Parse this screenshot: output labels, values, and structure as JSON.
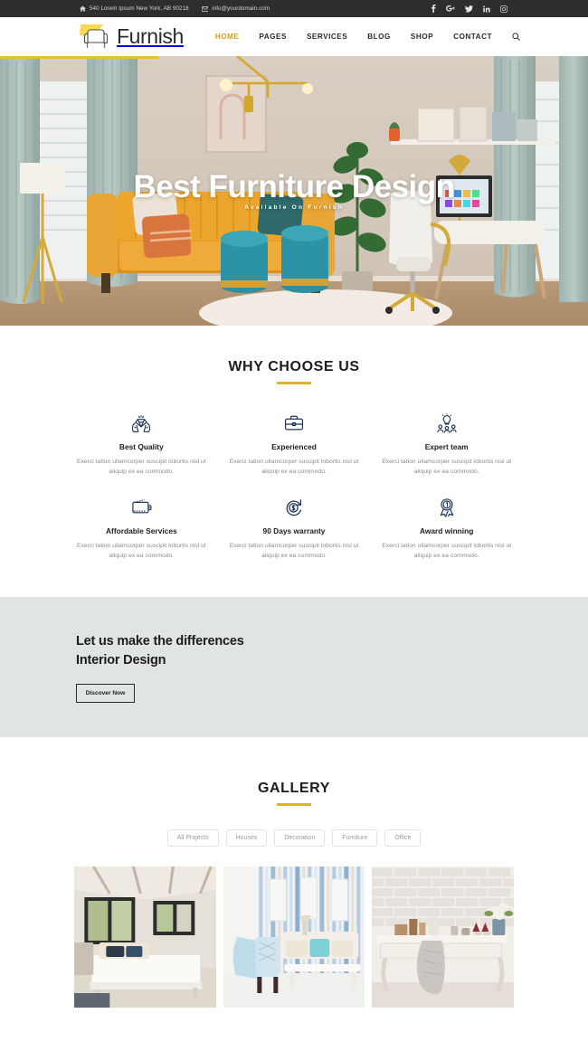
{
  "colors": {
    "accent": "#d4a017",
    "rule": "#e0b42a",
    "topbar_bg": "#2e2e2e",
    "band_bg": "#e1e5e1",
    "icon_navy": "#1d3557",
    "text_dark": "#1c1c1c",
    "text_muted": "#8b8b8b"
  },
  "topbar": {
    "address": "540 Lorem Ipsum New York, AB 90218",
    "email": "info@yourdomain.com",
    "address_icon": "home-icon",
    "email_icon": "envelope-icon",
    "socials": [
      {
        "name": "facebook-icon",
        "label": "f"
      },
      {
        "name": "google-plus-icon",
        "label": "G+"
      },
      {
        "name": "twitter-icon",
        "label": "t"
      },
      {
        "name": "linkedin-icon",
        "label": "in"
      },
      {
        "name": "instagram-icon",
        "label": "ig"
      }
    ]
  },
  "nav": {
    "brand": "Furnish",
    "logo_icon": "armchair-logo-icon",
    "search_icon": "search-icon",
    "items": [
      {
        "label": "HOME",
        "active": true
      },
      {
        "label": "PAGES",
        "active": false
      },
      {
        "label": "SERVICES",
        "active": false
      },
      {
        "label": "BLOG",
        "active": false
      },
      {
        "label": "SHOP",
        "active": false
      },
      {
        "label": "CONTACT",
        "active": false
      }
    ]
  },
  "hero": {
    "title": "Best Furniture Design",
    "subtitle": "Available On Furnish",
    "scene_alt": "Living room with orange sofa, teal ottomans, desk and chair"
  },
  "why": {
    "title": "WHY CHOOSE US",
    "features": [
      {
        "icon": "diamond-in-hands-icon",
        "title": "Best Quality",
        "desc": "Exerci tation ullamcorper suscipit lobortis nisl ut aliquip ex ea commodo."
      },
      {
        "icon": "briefcase-icon",
        "title": "Experienced",
        "desc": "Exerci tation ullamcorper suscipit lobortis nisl ut aliquip ex ea commodo."
      },
      {
        "icon": "lightbulb-team-icon",
        "title": "Expert team",
        "desc": "Exerci tation ullamcorper suscipit lobortis nisl ut aliquip ex ea commodo."
      },
      {
        "icon": "wallet-icon",
        "title": "Affordable Services",
        "desc": "Exerci tation ullamcorper suscipit lobortis nisl ut aliquip ex ea commodo."
      },
      {
        "icon": "money-back-icon",
        "title": "90 Days warranty",
        "desc": "Exerci tation ullamcorper suscipit lobortis nisl ut aliquip ex ea commodo."
      },
      {
        "icon": "award-medal-icon",
        "title": "Award winning",
        "desc": "Exerci tation ullamcorper suscipit lobortis nisl ut aliquip ex ea commodo."
      }
    ]
  },
  "band": {
    "line1": "Let us make the differences",
    "line2": "Interior Design",
    "button": "Discover Now"
  },
  "gallery": {
    "title": "GALLERY",
    "filters": [
      {
        "label": "All Projects",
        "active": true
      },
      {
        "label": "Houses",
        "active": false
      },
      {
        "label": "Decoration",
        "active": false
      },
      {
        "label": "Furniture",
        "active": false
      },
      {
        "label": "Office",
        "active": false
      }
    ],
    "items": [
      {
        "alt": "Bedroom with white bed, beamed ceiling and large windows"
      },
      {
        "alt": "Living room with blue tufted chair, striped curtains and white coffee table"
      },
      {
        "alt": "Console table with flowers, wine glasses and grey throw against white brick wall"
      }
    ]
  }
}
